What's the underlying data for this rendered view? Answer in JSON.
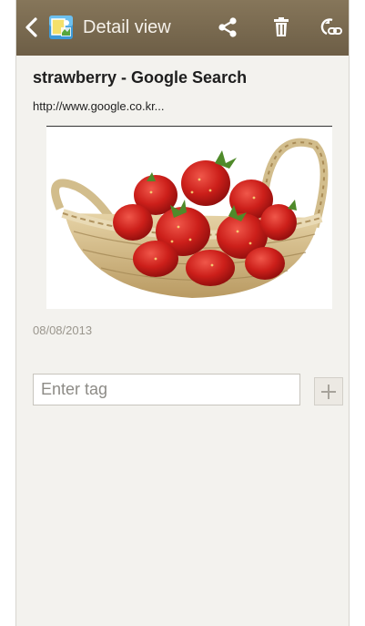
{
  "header": {
    "title": "Detail view",
    "actions": [
      {
        "name": "share-icon"
      },
      {
        "name": "delete-icon"
      },
      {
        "name": "link-icon"
      }
    ]
  },
  "page": {
    "title": "strawberry - Google Search",
    "url": "http://www.google.co.kr...",
    "date": "08/08/2013"
  },
  "tag": {
    "placeholder": "Enter tag",
    "value": ""
  },
  "colors": {
    "actionbar": "#7a6a50",
    "background": "#f3f2ee",
    "strawberry": "#c8201c"
  }
}
